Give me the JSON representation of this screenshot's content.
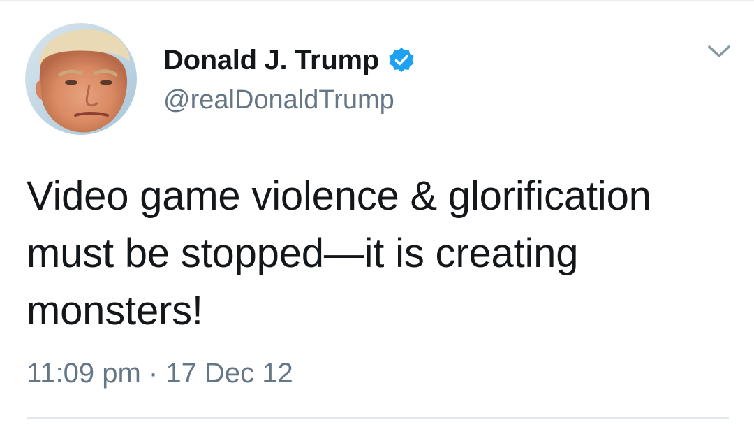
{
  "tweet": {
    "author": {
      "display_name": "Donald J. Trump",
      "handle": "@realDonaldTrump",
      "verified": true,
      "avatar_icon": "profile-photo"
    },
    "text": "Video game violence & glorification must be stopped—it is creating monsters!",
    "timestamp": "11:09 pm · 17 Dec 12",
    "menu_icon": "chevron-down-icon"
  },
  "colors": {
    "primary_text": "#14171a",
    "secondary_text": "#657786",
    "verified_badge": "#1da1f2",
    "divider": "#e1e8ed"
  }
}
